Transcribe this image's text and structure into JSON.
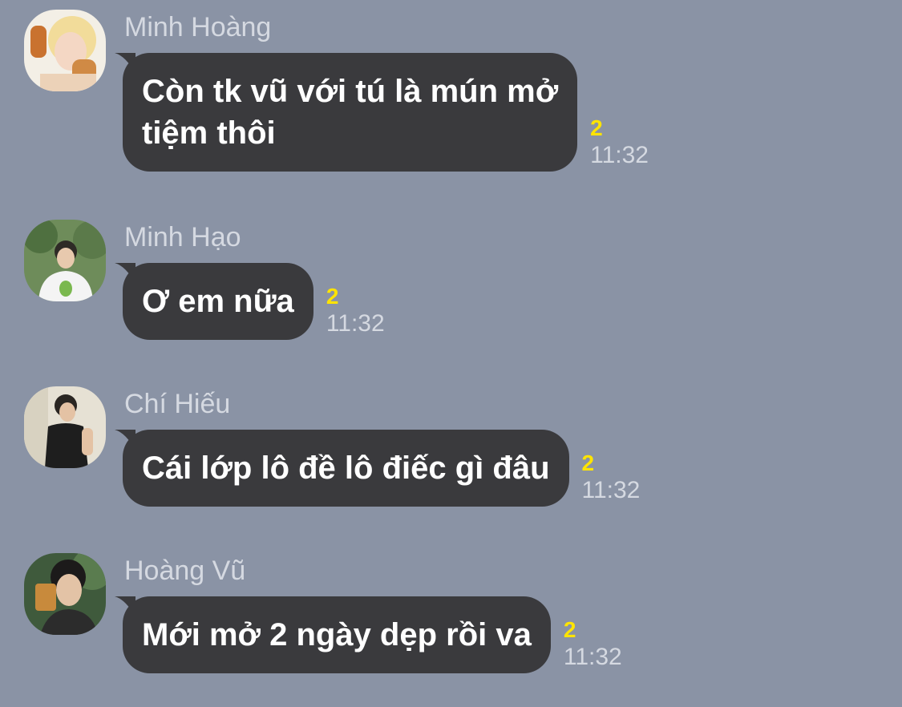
{
  "messages": [
    {
      "sender": "Minh Hoàng",
      "avatar": "user-avatar-minh-hoang",
      "text": "Còn tk vũ với tú là mún mở\ntiệm thôi",
      "read_count": "2",
      "time": "11:32"
    },
    {
      "sender": "Minh Hạo",
      "avatar": "user-avatar-minh-hao",
      "text": "Ơ em nữa",
      "read_count": "2",
      "time": "11:32"
    },
    {
      "sender": "Chí Hiếu",
      "avatar": "user-avatar-chi-hieu",
      "text": "Cái lớp lô đề lô điếc gì đâu",
      "read_count": "2",
      "time": "11:32"
    },
    {
      "sender": "Hoàng Vũ",
      "avatar": "user-avatar-hoang-vu",
      "text": "Mới mở 2 ngày dẹp rồi va",
      "read_count": "2",
      "time": "11:32"
    }
  ],
  "colors": {
    "background": "#8a93a5",
    "bubble": "#3a3a3d",
    "read_count": "#ffe400",
    "meta_text": "#d5d9e1"
  }
}
